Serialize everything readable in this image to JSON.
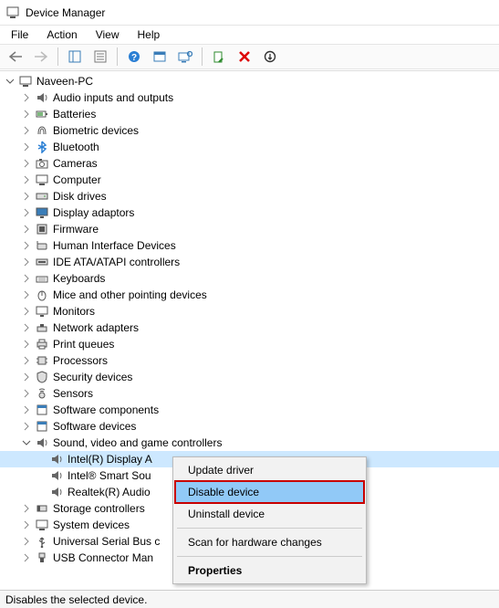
{
  "title": "Device Manager",
  "menu": {
    "file": "File",
    "action": "Action",
    "view": "View",
    "help": "Help"
  },
  "root": "Naveen-PC",
  "categories": [
    "Audio inputs and outputs",
    "Batteries",
    "Biometric devices",
    "Bluetooth",
    "Cameras",
    "Computer",
    "Disk drives",
    "Display adaptors",
    "Firmware",
    "Human Interface Devices",
    "IDE ATA/ATAPI controllers",
    "Keyboards",
    "Mice and other pointing devices",
    "Monitors",
    "Network adapters",
    "Print queues",
    "Processors",
    "Security devices",
    "Sensors",
    "Software components",
    "Software devices"
  ],
  "sound_category": "Sound, video and game controllers",
  "sound_devices": [
    "Intel(R) Display A",
    "Intel® Smart Sou",
    "Realtek(R) Audio"
  ],
  "tail_categories": [
    "Storage controllers",
    "System devices",
    "Universal Serial Bus c",
    "USB Connector Man"
  ],
  "context_menu": {
    "update": "Update driver",
    "disable": "Disable device",
    "uninstall": "Uninstall device",
    "scan": "Scan for hardware changes",
    "properties": "Properties"
  },
  "status": "Disables the selected device."
}
